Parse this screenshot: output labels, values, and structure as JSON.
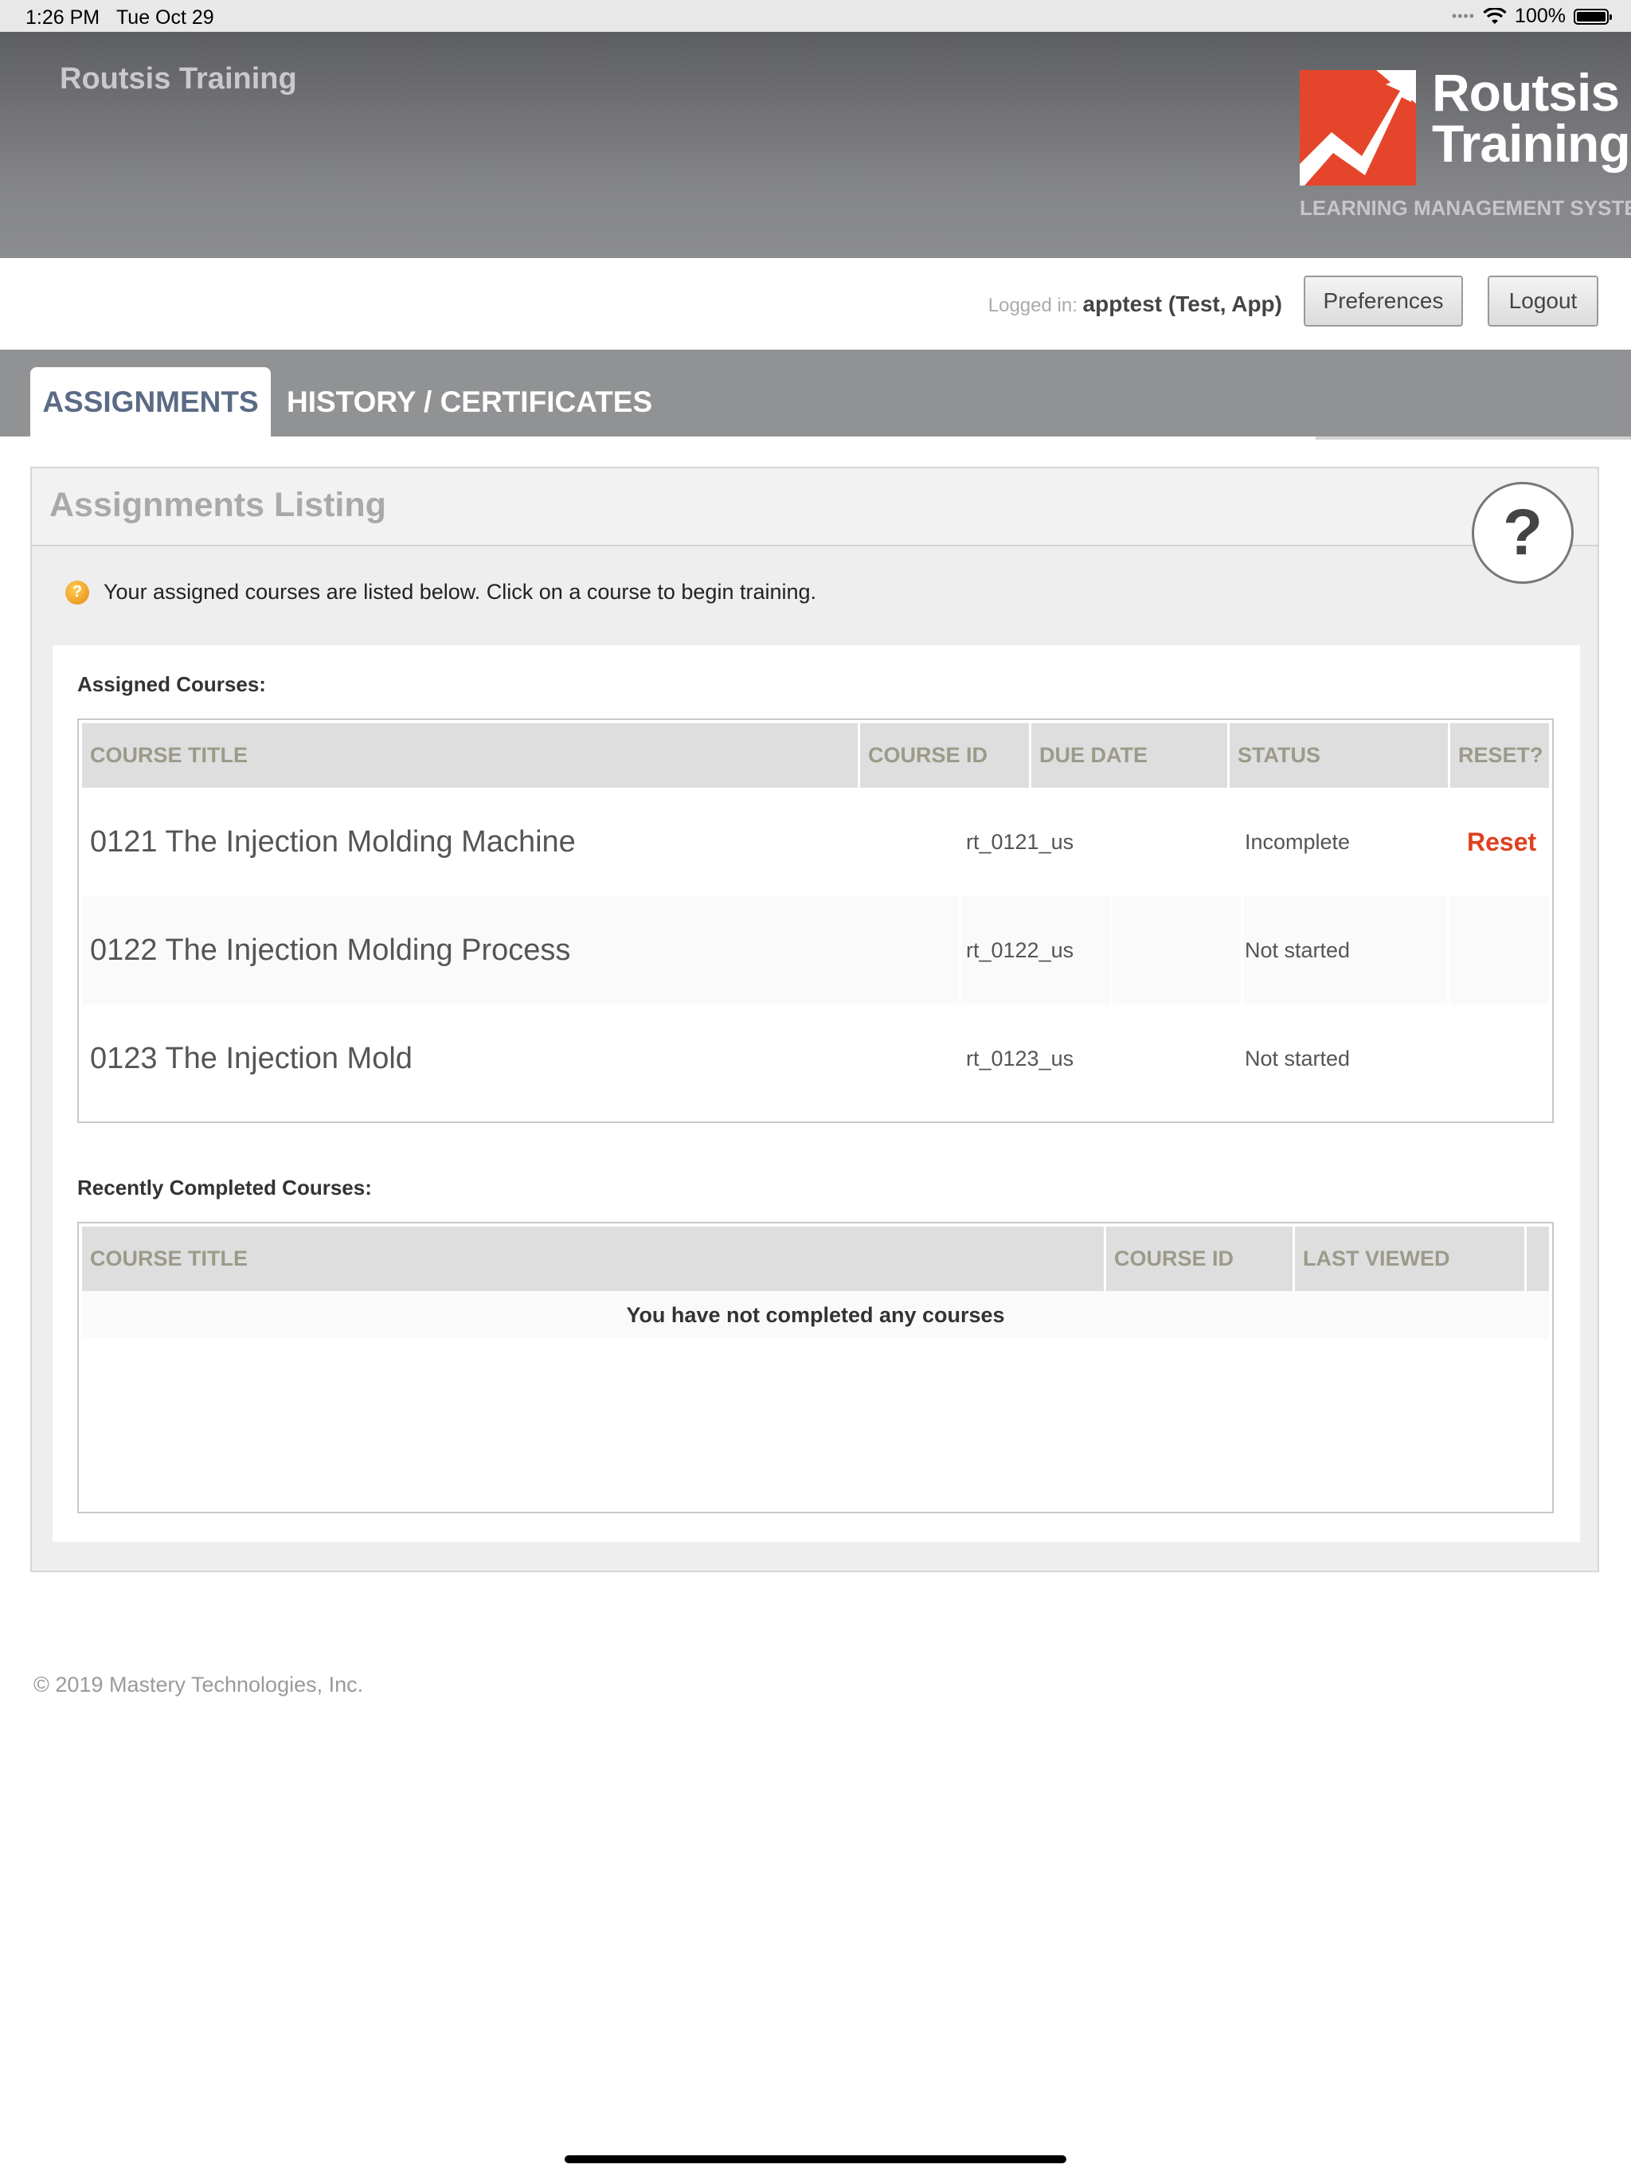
{
  "status_bar": {
    "time": "1:26 PM",
    "date": "Tue Oct 29",
    "battery": "100%"
  },
  "header": {
    "site_name": "Routsis Training",
    "logo_line1": "Routsis",
    "logo_line2": "Training",
    "logo_subtitle": "LEARNING MANAGEMENT SYSTEM"
  },
  "user": {
    "logged_in_label": "Logged in:",
    "username": "apptest (Test, App)",
    "preferences_label": "Preferences",
    "logout_label": "Logout"
  },
  "tabs": [
    {
      "label": "ASSIGNMENTS",
      "active": true
    },
    {
      "label": "HISTORY / CERTIFICATES",
      "active": false
    }
  ],
  "panel": {
    "title": "Assignments Listing",
    "help_glyph": "?",
    "info_text": "Your assigned courses are listed below. Click on a course to begin training."
  },
  "assigned": {
    "label": "Assigned Courses:",
    "headers": [
      "COURSE TITLE",
      "COURSE ID",
      "DUE DATE",
      "STATUS",
      "RESET?"
    ],
    "rows": [
      {
        "title": "0121 The Injection Molding Machine",
        "id": "rt_0121_us",
        "due": "",
        "status": "Incomplete",
        "reset": "Reset"
      },
      {
        "title": "0122 The Injection Molding Process",
        "id": "rt_0122_us",
        "due": "",
        "status": "Not started",
        "reset": ""
      },
      {
        "title": "0123 The Injection Mold",
        "id": "rt_0123_us",
        "due": "",
        "status": "Not started",
        "reset": ""
      }
    ]
  },
  "completed": {
    "label": "Recently Completed Courses:",
    "headers": [
      "COURSE TITLE",
      "COURSE ID",
      "LAST VIEWED"
    ],
    "empty_message": "You have not completed any courses"
  },
  "footer": {
    "copyright": "© 2019 Mastery Technologies, Inc."
  },
  "colors": {
    "accent_red": "#e0401f",
    "tab_active_text": "#5b6b86",
    "header_gray": "#858689"
  },
  "icons": {
    "wifi": "wifi-icon",
    "battery": "battery-icon",
    "help": "help-icon",
    "info": "info-icon"
  }
}
